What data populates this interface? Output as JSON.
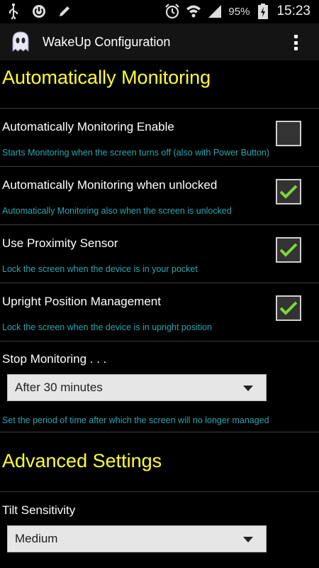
{
  "status_bar": {
    "icons_left": [
      "usb-icon",
      "power-icon",
      "pencil-icon"
    ],
    "icons_right": [
      "alarm-icon",
      "wifi-icon",
      "signal-icon",
      "battery-charging-icon"
    ],
    "battery": "95%",
    "time": "15:23"
  },
  "action_bar": {
    "title": "WakeUp Configuration",
    "app_icon": "ghost-icon",
    "menu_icon": "overflow-menu-icon"
  },
  "sections": {
    "auto_monitoring": "Automatically Monitoring",
    "advanced": "Advanced Settings"
  },
  "prefs": {
    "enable": {
      "title": "Automatically Monitoring Enable",
      "summary": "Starts Monitoring when the screen turns off (also with Power Button)",
      "checked": false
    },
    "unlocked": {
      "title": "Automatically Monitoring when unlocked",
      "summary": "Automatically Monitoring also when the screen is unlocked",
      "checked": true
    },
    "proximity": {
      "title": "Use Proximity Sensor",
      "summary": "Lock the screen when the device is in your pocket",
      "checked": true
    },
    "upright": {
      "title": "Upright Position Management",
      "summary": "Lock the screen when the device is in upright position",
      "checked": true
    },
    "stop": {
      "title": "Stop Monitoring . . .",
      "value": "After 30 minutes",
      "summary": "Set the period of time after which the screen will no longer managed"
    },
    "tilt": {
      "title": "Tilt Sensitivity",
      "value": "Medium"
    }
  },
  "colors": {
    "accent_yellow": "#ffff33",
    "summary_teal": "#2aa6b0",
    "check_green": "#7dd63a"
  }
}
